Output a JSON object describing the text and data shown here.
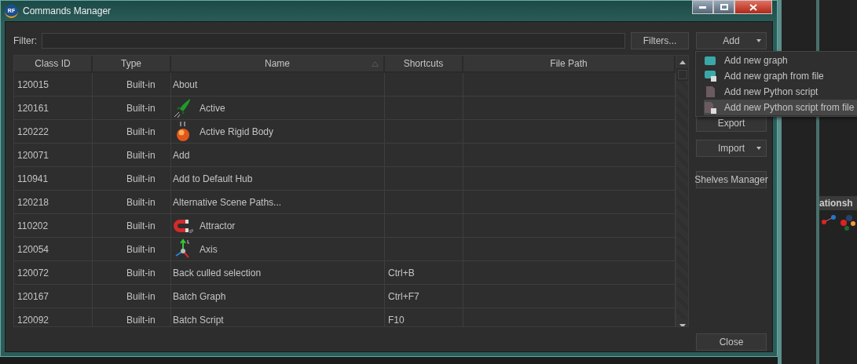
{
  "window": {
    "title": "Commands Manager",
    "logo": "RF"
  },
  "filter": {
    "label": "Filter:"
  },
  "filters_button": "Filters...",
  "add_button": "Add",
  "table": {
    "columns": [
      {
        "label": "Class ID",
        "sorted": false
      },
      {
        "label": "Type",
        "sorted": false
      },
      {
        "label": "Name",
        "sorted": true
      },
      {
        "label": "Shortcuts",
        "sorted": false
      },
      {
        "label": "File Path",
        "sorted": false
      }
    ],
    "rows": [
      {
        "class_id": "120015",
        "type": "Built-in",
        "name": "About"
      },
      {
        "class_id": "120161",
        "type": "Built-in",
        "name": "Active"
      },
      {
        "class_id": "120222",
        "type": "Built-in",
        "name": "Active Rigid Body"
      },
      {
        "class_id": "120071",
        "type": "Built-in",
        "name": "Add"
      },
      {
        "class_id": "110941",
        "type": "Built-in",
        "name": "Add to Default Hub"
      },
      {
        "class_id": "120218",
        "type": "Built-in",
        "name": "Alternative Scene Paths..."
      },
      {
        "class_id": "110202",
        "type": "Built-in",
        "name": "Attractor"
      },
      {
        "class_id": "120054",
        "type": "Built-in",
        "name": "Axis"
      },
      {
        "class_id": "120072",
        "type": "Built-in",
        "name": "Back culled selection",
        "shortcut": "Ctrl+B"
      },
      {
        "class_id": "120167",
        "type": "Built-in",
        "name": "Batch Graph",
        "shortcut": "Ctrl+F7"
      },
      {
        "class_id": "120092",
        "type": "Built-in",
        "name": "Batch Script",
        "shortcut": "F10"
      }
    ]
  },
  "add_menu": {
    "items": [
      {
        "label": "Add new graph",
        "selected": false
      },
      {
        "label": "Add new graph from file",
        "selected": false
      },
      {
        "label": "Add new Python script",
        "selected": false
      },
      {
        "label": "Add new Python script from file",
        "selected": true
      }
    ]
  },
  "side_buttons": [
    {
      "label": "Export",
      "kind": "plain"
    },
    {
      "label": "Import",
      "kind": "dropdown"
    },
    {
      "label": "Shelves Manager",
      "kind": "plain"
    }
  ],
  "close_button": "Close",
  "background_panel": {
    "title": "ationsh"
  }
}
